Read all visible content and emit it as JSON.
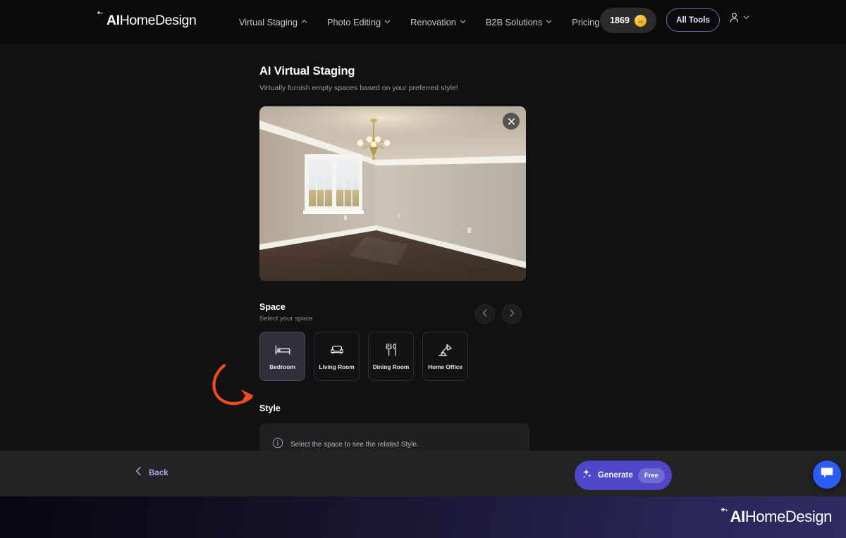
{
  "nav": {
    "logo": {
      "mark": "sparkle-icon",
      "bold": "AI",
      "rest": "HomeDesign"
    },
    "items": [
      {
        "label": "Virtual Staging",
        "caret": "chevron-up-icon"
      },
      {
        "label": "Photo Editing",
        "caret": "chevron-down-icon"
      },
      {
        "label": "Renovation",
        "caret": "chevron-down-icon"
      },
      {
        "label": "B2B Solutions",
        "caret": "chevron-down-icon"
      },
      {
        "label": "Pricing",
        "caret": "none"
      }
    ],
    "credits": {
      "amount": "1869",
      "icon": "coin-icon"
    },
    "all_tools_label": "All Tools",
    "account": {
      "icon": "user-icon",
      "caret": "chevron-down-icon"
    }
  },
  "page": {
    "title": "AI Virtual Staging",
    "subtitle": "Virtually furnish empty spaces based on your preferred style!"
  },
  "preview": {
    "alt": "empty bedroom with beige walls, chandelier, window and dark hardwood floor",
    "close_icon": "close-icon"
  },
  "space": {
    "title": "Space",
    "subtitle": "Select your space",
    "prev_icon": "chevron-left-icon",
    "next_icon": "chevron-right-icon",
    "cards": [
      {
        "label": "Bedroom",
        "icon": "bed-icon",
        "selected": true
      },
      {
        "label": "Living Room",
        "icon": "sofa-icon",
        "selected": false
      },
      {
        "label": "Dining Room",
        "icon": "cutlery-icon",
        "selected": false
      },
      {
        "label": "Home Office",
        "icon": "desk-lamp-icon",
        "selected": false
      }
    ]
  },
  "style": {
    "title": "Style",
    "info_icon": "info-icon",
    "info_text": "Select the space to see the related Style."
  },
  "bottom_bar": {
    "back_label": "Back",
    "back_icon": "chevron-left-icon",
    "generate_label": "Generate",
    "generate_icon": "sparkle-icon",
    "free_badge": "Free",
    "chat_icon": "chat-bubble-icon"
  },
  "footer": {
    "logo": {
      "mark": "sparkle-icon",
      "bold": "AI",
      "rest": "HomeDesign"
    }
  },
  "annotation": {
    "icon": "curved-arrow-icon",
    "color": "#f04a23"
  },
  "colors": {
    "accent_purple": "#4f46c8",
    "back_link": "#a9a6e8",
    "all_tools_border": "#6f6cb5",
    "chat_blue": "#2b5cf6",
    "coin_gold": "#f5b82e",
    "annotation_orange": "#f04a23",
    "page_bg": "#111113",
    "nav_bg": "#0b0b0c",
    "bottom_bar_bg": "#232325"
  }
}
